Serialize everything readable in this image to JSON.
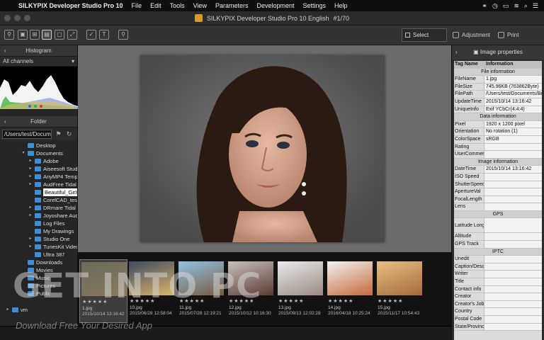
{
  "menubar": {
    "apple_icon": "apple-icon",
    "app_name": "SILKYPIX Developer Studio Pro 10",
    "items": [
      "File",
      "Edit",
      "Tools",
      "View",
      "Parameters",
      "Development",
      "Settings",
      "Help"
    ]
  },
  "window": {
    "title": "SILKYPIX Developer Studio Pro 10 English",
    "counter": "#1/70"
  },
  "modes": {
    "select": "Select",
    "adjustment": "Adjustment",
    "print": "Print"
  },
  "histogram": {
    "title": "Histogram",
    "channel": "All channels"
  },
  "folder": {
    "title": "Folder",
    "path": "/Users/test/Docume",
    "tree": [
      {
        "label": "Desktop"
      },
      {
        "label": "Documents"
      },
      {
        "label": "Adobe"
      },
      {
        "label": "Aiseesoft Studio"
      },
      {
        "label": "AnyMP4 Temp"
      },
      {
        "label": "AudFree Tidal M"
      },
      {
        "label": "Beautiful_Girls_"
      },
      {
        "label": "CorelCAD_test_"
      },
      {
        "label": "DRmare Tidal M"
      },
      {
        "label": "Joyoshare Audio"
      },
      {
        "label": "Log Files"
      },
      {
        "label": "My Drawings"
      },
      {
        "label": "Studio One"
      },
      {
        "label": "TunesKit Video"
      },
      {
        "label": "Ultra 387"
      },
      {
        "label": "Downloads"
      },
      {
        "label": "Movies"
      },
      {
        "label": "Music"
      },
      {
        "label": "Pictures"
      },
      {
        "label": "Public"
      },
      {
        "label": "vm"
      }
    ]
  },
  "filmstrip": [
    {
      "name": "1.jpg",
      "date": "2015/10/14 13:16:42"
    },
    {
      "name": "10.jpg",
      "date": "2015/06/28 12:58:04"
    },
    {
      "name": "11.jpg",
      "date": "2015/07/28 12:19:21"
    },
    {
      "name": "12.jpg",
      "date": "2015/10/12 10:16:30"
    },
    {
      "name": "13.jpg",
      "date": "2015/09/13 12:02:28"
    },
    {
      "name": "14.jpg",
      "date": "2016/04/18 10:25:24"
    },
    {
      "name": "15.jpg",
      "date": "2015/11/17 10:54:43"
    }
  ],
  "rating_stars": "★★★★★",
  "properties": {
    "title": "Image properties",
    "col_tag": "Tag Name",
    "col_info": "Information",
    "rows": [
      {
        "type": "sec",
        "k": "File information"
      },
      {
        "k": "FileName",
        "v": "1.jpg"
      },
      {
        "k": "FileSize",
        "v": "745.96KB (763862Byte)"
      },
      {
        "k": "FilePath",
        "v": "/Users/test/Documents/Be"
      },
      {
        "k": "UpdateTime",
        "v": "2015/10/14 13:16:42"
      },
      {
        "k": "UniqueInfo",
        "v": "Exif YCbCr(4:4:4)"
      },
      {
        "type": "sec",
        "k": "Data information"
      },
      {
        "k": "Pixel",
        "v": "1920 x 1200 pixel"
      },
      {
        "k": "Orientation",
        "v": "No rotation (1)"
      },
      {
        "k": "ColorSpace",
        "v": "sRGB"
      },
      {
        "k": "Rating",
        "v": ""
      },
      {
        "k": "UserComment",
        "v": ""
      },
      {
        "type": "sec",
        "k": "Image information"
      },
      {
        "k": "DateTime",
        "v": "2015/10/14 13:16:42"
      },
      {
        "k": "ISO Speed",
        "v": ""
      },
      {
        "k": "ShutterSpeed",
        "v": ""
      },
      {
        "k": "ApertureVal",
        "v": ""
      },
      {
        "k": "FocalLength",
        "v": ""
      },
      {
        "k": "Lens",
        "v": ""
      },
      {
        "type": "sec",
        "k": "GPS"
      },
      {
        "type": "tall",
        "k": "Latitude Longi",
        "v": ""
      },
      {
        "k": "Altitude",
        "v": ""
      },
      {
        "k": "GPS Track",
        "v": ""
      },
      {
        "type": "sec",
        "k": "IPTC"
      },
      {
        "k": "Unedit",
        "v": ""
      },
      {
        "k": "Caption/Descr",
        "v": ""
      },
      {
        "k": "Writer",
        "v": ""
      },
      {
        "k": "Title",
        "v": ""
      },
      {
        "k": "Contact info",
        "v": ""
      },
      {
        "k": "Creator",
        "v": ""
      },
      {
        "k": "Creator's Jobti",
        "v": ""
      },
      {
        "k": "Country",
        "v": ""
      },
      {
        "k": "Postal Code",
        "v": ""
      },
      {
        "k": "State/Province",
        "v": ""
      }
    ]
  },
  "watermark": {
    "main": "GET INTO PC",
    "sub": "Download Free Your Desired App"
  }
}
